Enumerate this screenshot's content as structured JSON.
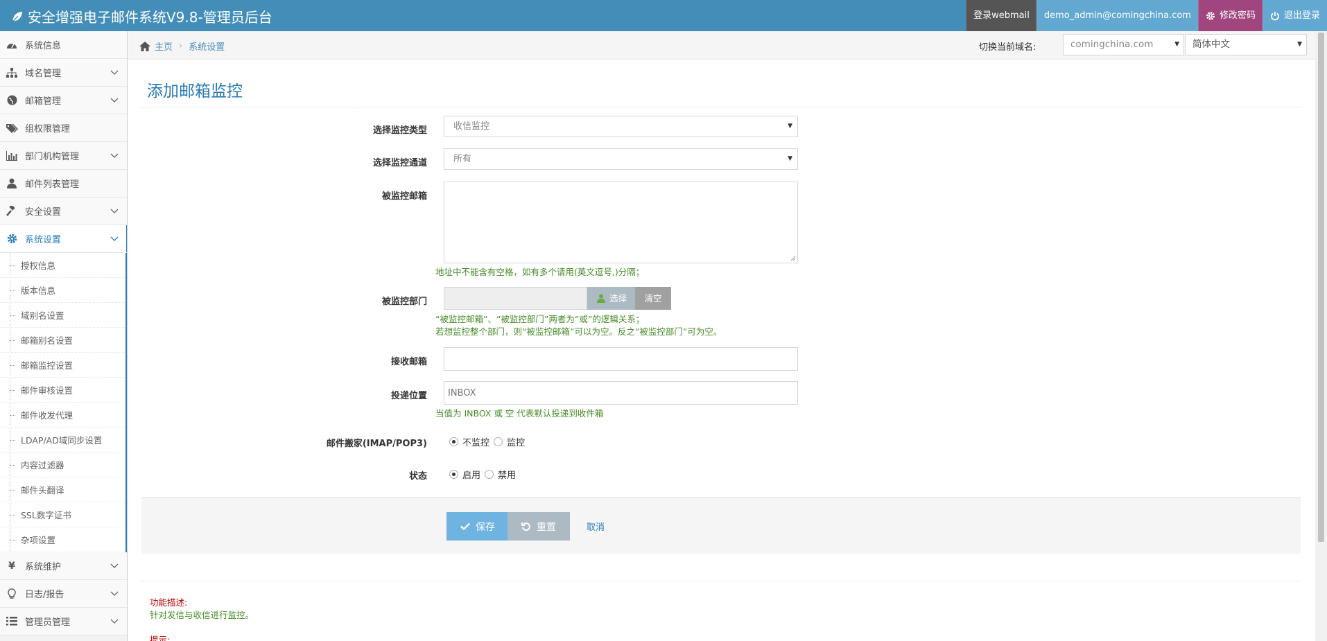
{
  "app": {
    "title": "安全增强电子邮件系统V9.8-管理员后台"
  },
  "topbar": {
    "webmail": "登录webmail",
    "user": "demo_admin@comingchina.com",
    "change_password": "修改密码",
    "logout": "退出登录"
  },
  "sidebar": {
    "items": [
      {
        "label": "系统信息",
        "icon": "dashboard-icon"
      },
      {
        "label": "域名管理",
        "icon": "sitemap-icon"
      },
      {
        "label": "邮箱管理",
        "icon": "globe-icon"
      },
      {
        "label": "组权限管理",
        "icon": "tags-icon"
      },
      {
        "label": "部门机构管理",
        "icon": "bar-chart-icon"
      },
      {
        "label": "邮件列表管理",
        "icon": "user-icon"
      },
      {
        "label": "安全设置",
        "icon": "gavel-icon"
      },
      {
        "label": "系统设置",
        "icon": "cog-icon"
      }
    ],
    "sub_items": [
      "授权信息",
      "版本信息",
      "域别名设置",
      "邮箱别名设置",
      "邮箱监控设置",
      "邮件审核设置",
      "邮件收发代理",
      "LDAP/AD域同步设置",
      "内容过滤器",
      "邮件头翻译",
      "SSL数字证书",
      "杂项设置"
    ],
    "bottom_items": [
      {
        "label": "系统维护",
        "icon": "yen-icon"
      },
      {
        "label": "日志/报告",
        "icon": "lightbulb-icon"
      },
      {
        "label": "管理员管理",
        "icon": "list-icon"
      }
    ]
  },
  "breadcrumb": {
    "home": "主页",
    "current": "系统设置"
  },
  "domain_switch": {
    "label": "切换当前域名:",
    "domain": "comingchina.com",
    "language": "简体中文"
  },
  "form": {
    "title": "添加邮箱监控",
    "monitor_type": {
      "label": "选择监控类型",
      "value": "收信监控"
    },
    "monitor_channel": {
      "label": "选择监控通道",
      "value": "所有"
    },
    "monitored_mailbox": {
      "label": "被监控邮箱",
      "value": "",
      "hint": "地址中不能含有空格，如有多个请用(英文逗号,)分隔；"
    },
    "monitored_dept": {
      "label": "被监控部门",
      "select_btn": "选择",
      "clear_btn": "清空",
      "hint1": "“被监控邮箱”、“被监控部门”两者为“或”的逻辑关系；",
      "hint2": "若想监控整个部门，则“被监控邮箱”可以为空。反之“被监控部门”可为空。"
    },
    "receive_mailbox": {
      "label": "接收邮箱",
      "value": ""
    },
    "delivery": {
      "label": "投递位置",
      "placeholder": "INBOX",
      "hint": "当值为 INBOX 或 空 代表默认投递到收件箱"
    },
    "fetch": {
      "label": "邮件搬家(IMAP/POP3)",
      "opt1": "不监控",
      "opt2": "监控"
    },
    "status": {
      "label": "状态",
      "opt1": "启用",
      "opt2": "禁用"
    }
  },
  "actions": {
    "save": "保存",
    "reset": "重置",
    "cancel": "取消"
  },
  "description": {
    "title": "功能描述:",
    "text": "针对发信与收信进行监控。",
    "tip": "提示:"
  },
  "colors": {
    "header": "#438eb9",
    "accent": "#2b7dbc",
    "hint": "#478b28",
    "pwd_btn": "#a0457e"
  }
}
